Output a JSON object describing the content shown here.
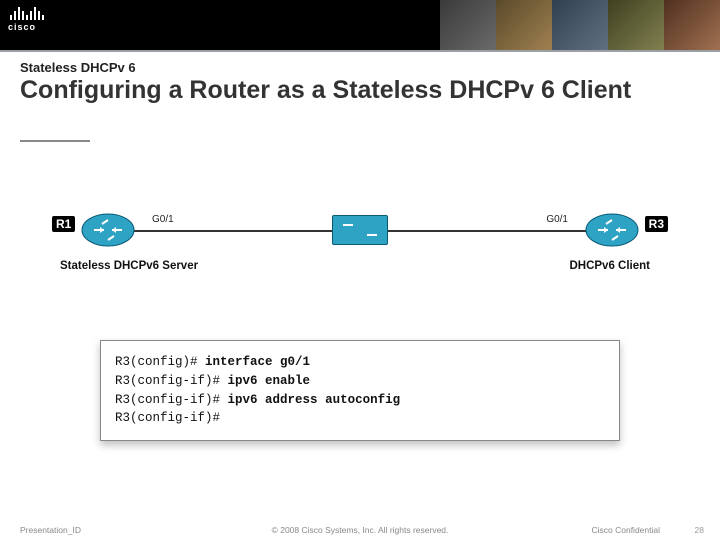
{
  "brand": {
    "name": "cisco"
  },
  "header": {
    "subtitle": "Stateless DHCPv 6",
    "title": "Configuring a Router as a Stateless DHCPv 6 Client"
  },
  "diagram": {
    "left_router": {
      "name": "R1",
      "interface": "G0/1",
      "role": "Stateless DHCPv6 Server"
    },
    "switch": {
      "name": "switch"
    },
    "right_router": {
      "name": "R3",
      "interface": "G0/1",
      "role": "DHCPv6 Client"
    }
  },
  "cli": {
    "lines": [
      {
        "prompt": "R3(config)#",
        "cmd": "interface g0/1"
      },
      {
        "prompt": "R3(config-if)#",
        "cmd": "ipv6 enable"
      },
      {
        "prompt": "R3(config-if)#",
        "cmd": "ipv6 address autoconfig"
      },
      {
        "prompt": "R3(config-if)#",
        "cmd": ""
      }
    ]
  },
  "footer": {
    "left": "Presentation_ID",
    "center": "© 2008 Cisco Systems, Inc. All rights reserved.",
    "right": "Cisco Confidential",
    "page": "28"
  }
}
